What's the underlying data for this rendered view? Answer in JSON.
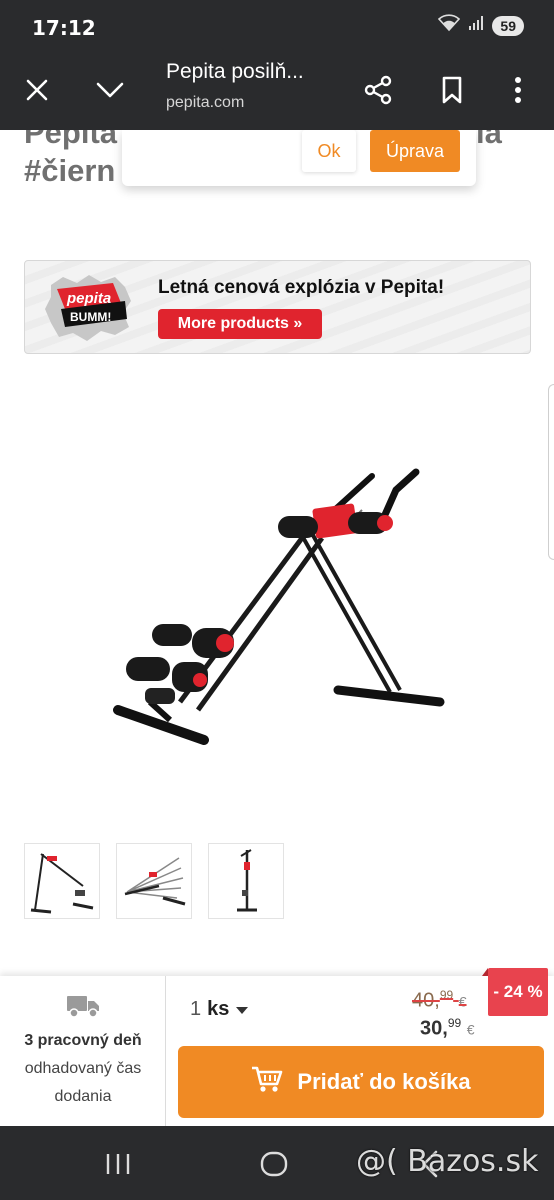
{
  "status_bar": {
    "time": "17:12",
    "battery": "59"
  },
  "browser": {
    "title": "Pepita posilň...",
    "url": "pepita.com"
  },
  "page": {
    "title_line1": "Pepita",
    "title_line1_right": "ia",
    "title_line2": "#čiern",
    "popup": {
      "ok_label": "Ok",
      "edit_label": "Úprava"
    },
    "banner": {
      "logo_top": "pepita",
      "logo_bottom": "BUMM!",
      "text": "Letná cenová explózia v Pepita!",
      "button_label": "More products »"
    }
  },
  "purchase": {
    "delivery_days": "3 pracovný deň",
    "delivery_line2": "odhadovaný čas",
    "delivery_line3": "dodania",
    "quantity": "1",
    "unit": "ks",
    "old_price_int": "40,",
    "old_price_dec": "99",
    "new_price_int": "30,",
    "new_price_dec": "99",
    "currency": "€",
    "discount": "- 24 %",
    "add_to_cart_label": "Pridať do košíka"
  },
  "watermark": "@( Bazos.sk",
  "colors": {
    "accent": "#f08a24",
    "brand_red": "#e0242e",
    "chrome": "#2a2b2d"
  }
}
